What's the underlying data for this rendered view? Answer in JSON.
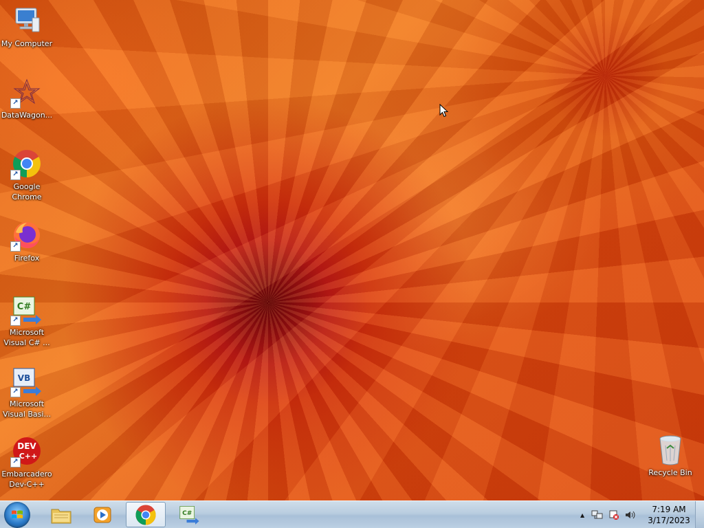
{
  "desktop": {
    "icons": [
      {
        "label": "My Computer"
      },
      {
        "label": "DataWagon..."
      },
      {
        "label": "Google\nChrome"
      },
      {
        "label": "Firefox"
      },
      {
        "label": "Microsoft\nVisual C# ..."
      },
      {
        "label": "Microsoft\nVisual Basi..."
      },
      {
        "label": "Embarcadero\nDev-C++"
      },
      {
        "label": "Recycle Bin"
      }
    ],
    "icon_badges": {
      "csharp": "C#",
      "vb": "VB",
      "devcpp_top": "DEV",
      "devcpp_bottom": "C++"
    }
  },
  "taskbar": {
    "pinned": [
      {
        "name": "Windows Explorer",
        "icon": "folder-icon"
      },
      {
        "name": "Windows Media Player",
        "icon": "media-player-icon"
      },
      {
        "name": "Google Chrome",
        "icon": "chrome-icon",
        "active": true
      },
      {
        "name": "Microsoft Visual C#",
        "icon": "csharp-icon"
      }
    ],
    "csharp_badge": "C#",
    "tray": {
      "expand_symbol": "▲",
      "time": "7:19 AM",
      "date": "3/17/2023"
    }
  },
  "colors": {
    "taskbar": "#b9cde0",
    "wallpaper_primary": "#e25a10",
    "wallpaper_center": "#8a0a12"
  }
}
